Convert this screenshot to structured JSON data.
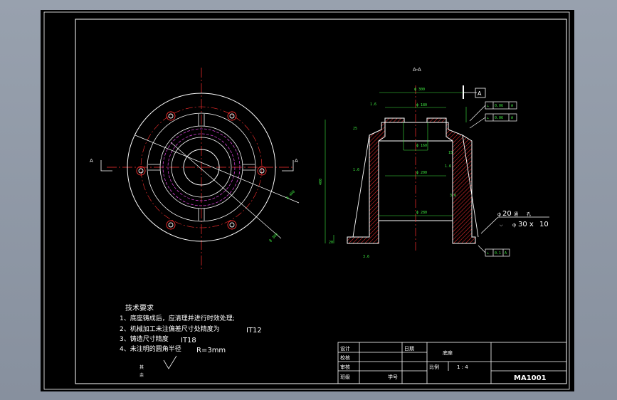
{
  "section_label": "A-A",
  "datum_label": "A",
  "left_cut_mark": "A",
  "right_cut_mark": "A",
  "tech": {
    "title": "技术要求",
    "items": [
      "1、底座铸成后，应清理并进行时效处理;",
      "2、机械加工未注偏差尺寸处精度为",
      "3、铸造尺寸精度",
      "4、未注明的圆角半径"
    ],
    "it12": "IT12",
    "it18": "IT18",
    "radius": "R=3mm"
  },
  "hole_note": {
    "depth": "20",
    "hole": "孔",
    "size": "30 x",
    "count": "10"
  },
  "roughness_note": {
    "line1": "其",
    "line2": "余"
  },
  "title_block": {
    "design": "设计",
    "check": "校核",
    "review": "审核",
    "class": "班级",
    "date": "日期",
    "part_name": "底座",
    "scale_label": "比例",
    "scale_value": "1 : 4",
    "student_no": "学号",
    "drawing_no": "MA1001"
  },
  "colors": {
    "background": "#000000",
    "outline": "#ffffff",
    "center_line": "#ff3030",
    "dimension": "#3ee840",
    "hatch": "#ff3030",
    "hidden": "#d040d0"
  }
}
